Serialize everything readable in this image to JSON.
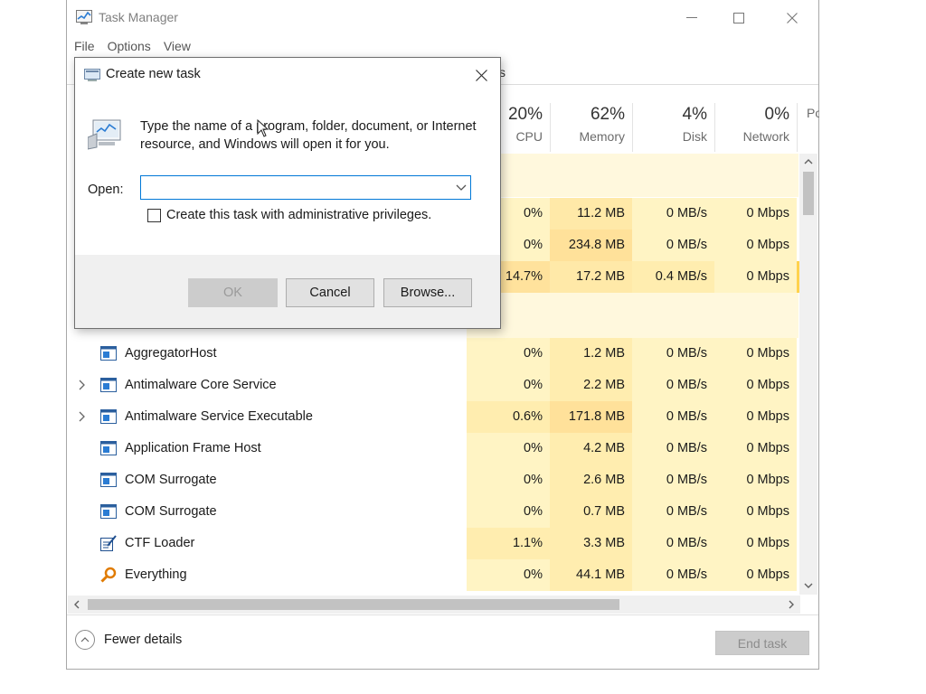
{
  "window": {
    "title": "Task Manager",
    "menu": [
      "File",
      "Options",
      "View"
    ],
    "tab_fragment": "s"
  },
  "columns": [
    {
      "pct": "20%",
      "label": "CPU"
    },
    {
      "pct": "62%",
      "label": "Memory"
    },
    {
      "pct": "4%",
      "label": "Disk"
    },
    {
      "pct": "0%",
      "label": "Network"
    },
    {
      "pct": "",
      "label": "Po"
    }
  ],
  "partial_rows": [
    {
      "cpu": "0%",
      "memory": "11.2 MB",
      "disk": "0 MB/s",
      "network": "0 Mbps"
    },
    {
      "cpu": "0%",
      "memory": "234.8 MB",
      "disk": "0 MB/s",
      "network": "0 Mbps"
    },
    {
      "cpu": "14.7%",
      "memory": "17.2 MB",
      "disk": "0.4 MB/s",
      "network": "0 Mbps"
    }
  ],
  "processes": [
    {
      "name": "AggregatorHost",
      "expandable": false,
      "icon": "window-app-icon",
      "cpu": "0%",
      "memory": "1.2 MB",
      "disk": "0 MB/s",
      "network": "0 Mbps"
    },
    {
      "name": "Antimalware Core Service",
      "expandable": true,
      "icon": "window-app-icon",
      "cpu": "0%",
      "memory": "2.2 MB",
      "disk": "0 MB/s",
      "network": "0 Mbps"
    },
    {
      "name": "Antimalware Service Executable",
      "expandable": true,
      "icon": "window-app-icon",
      "cpu": "0.6%",
      "memory": "171.8 MB",
      "disk": "0 MB/s",
      "network": "0 Mbps"
    },
    {
      "name": "Application Frame Host",
      "expandable": false,
      "icon": "window-app-icon",
      "cpu": "0%",
      "memory": "4.2 MB",
      "disk": "0 MB/s",
      "network": "0 Mbps"
    },
    {
      "name": "COM Surrogate",
      "expandable": false,
      "icon": "window-app-icon",
      "cpu": "0%",
      "memory": "2.6 MB",
      "disk": "0 MB/s",
      "network": "0 Mbps"
    },
    {
      "name": "COM Surrogate",
      "expandable": false,
      "icon": "window-app-icon",
      "cpu": "0%",
      "memory": "0.7 MB",
      "disk": "0 MB/s",
      "network": "0 Mbps"
    },
    {
      "name": "CTF Loader",
      "expandable": false,
      "icon": "ctf-loader-icon",
      "cpu": "1.1%",
      "memory": "3.3 MB",
      "disk": "0 MB/s",
      "network": "0 Mbps"
    },
    {
      "name": "Everything",
      "expandable": false,
      "icon": "everything-search-icon",
      "cpu": "0%",
      "memory": "44.1 MB",
      "disk": "0 MB/s",
      "network": "0 Mbps"
    }
  ],
  "footer": {
    "fewer_details": "Fewer details",
    "end_task": "End task"
  },
  "dialog": {
    "title": "Create new task",
    "description": "Type the name of a program, folder, document, or Internet resource, and Windows will open it for you.",
    "open_label": "Open:",
    "open_value": "",
    "admin_checkbox_label": "Create this task with administrative privileges.",
    "admin_checked": false,
    "ok_label": "OK",
    "cancel_label": "Cancel",
    "browse_label": "Browse..."
  },
  "colors": {
    "heat_light": "#fff4c4",
    "heat_mid": "#fff0b4",
    "heat_strong": "#ffe29c",
    "accent": "#0078d7"
  }
}
